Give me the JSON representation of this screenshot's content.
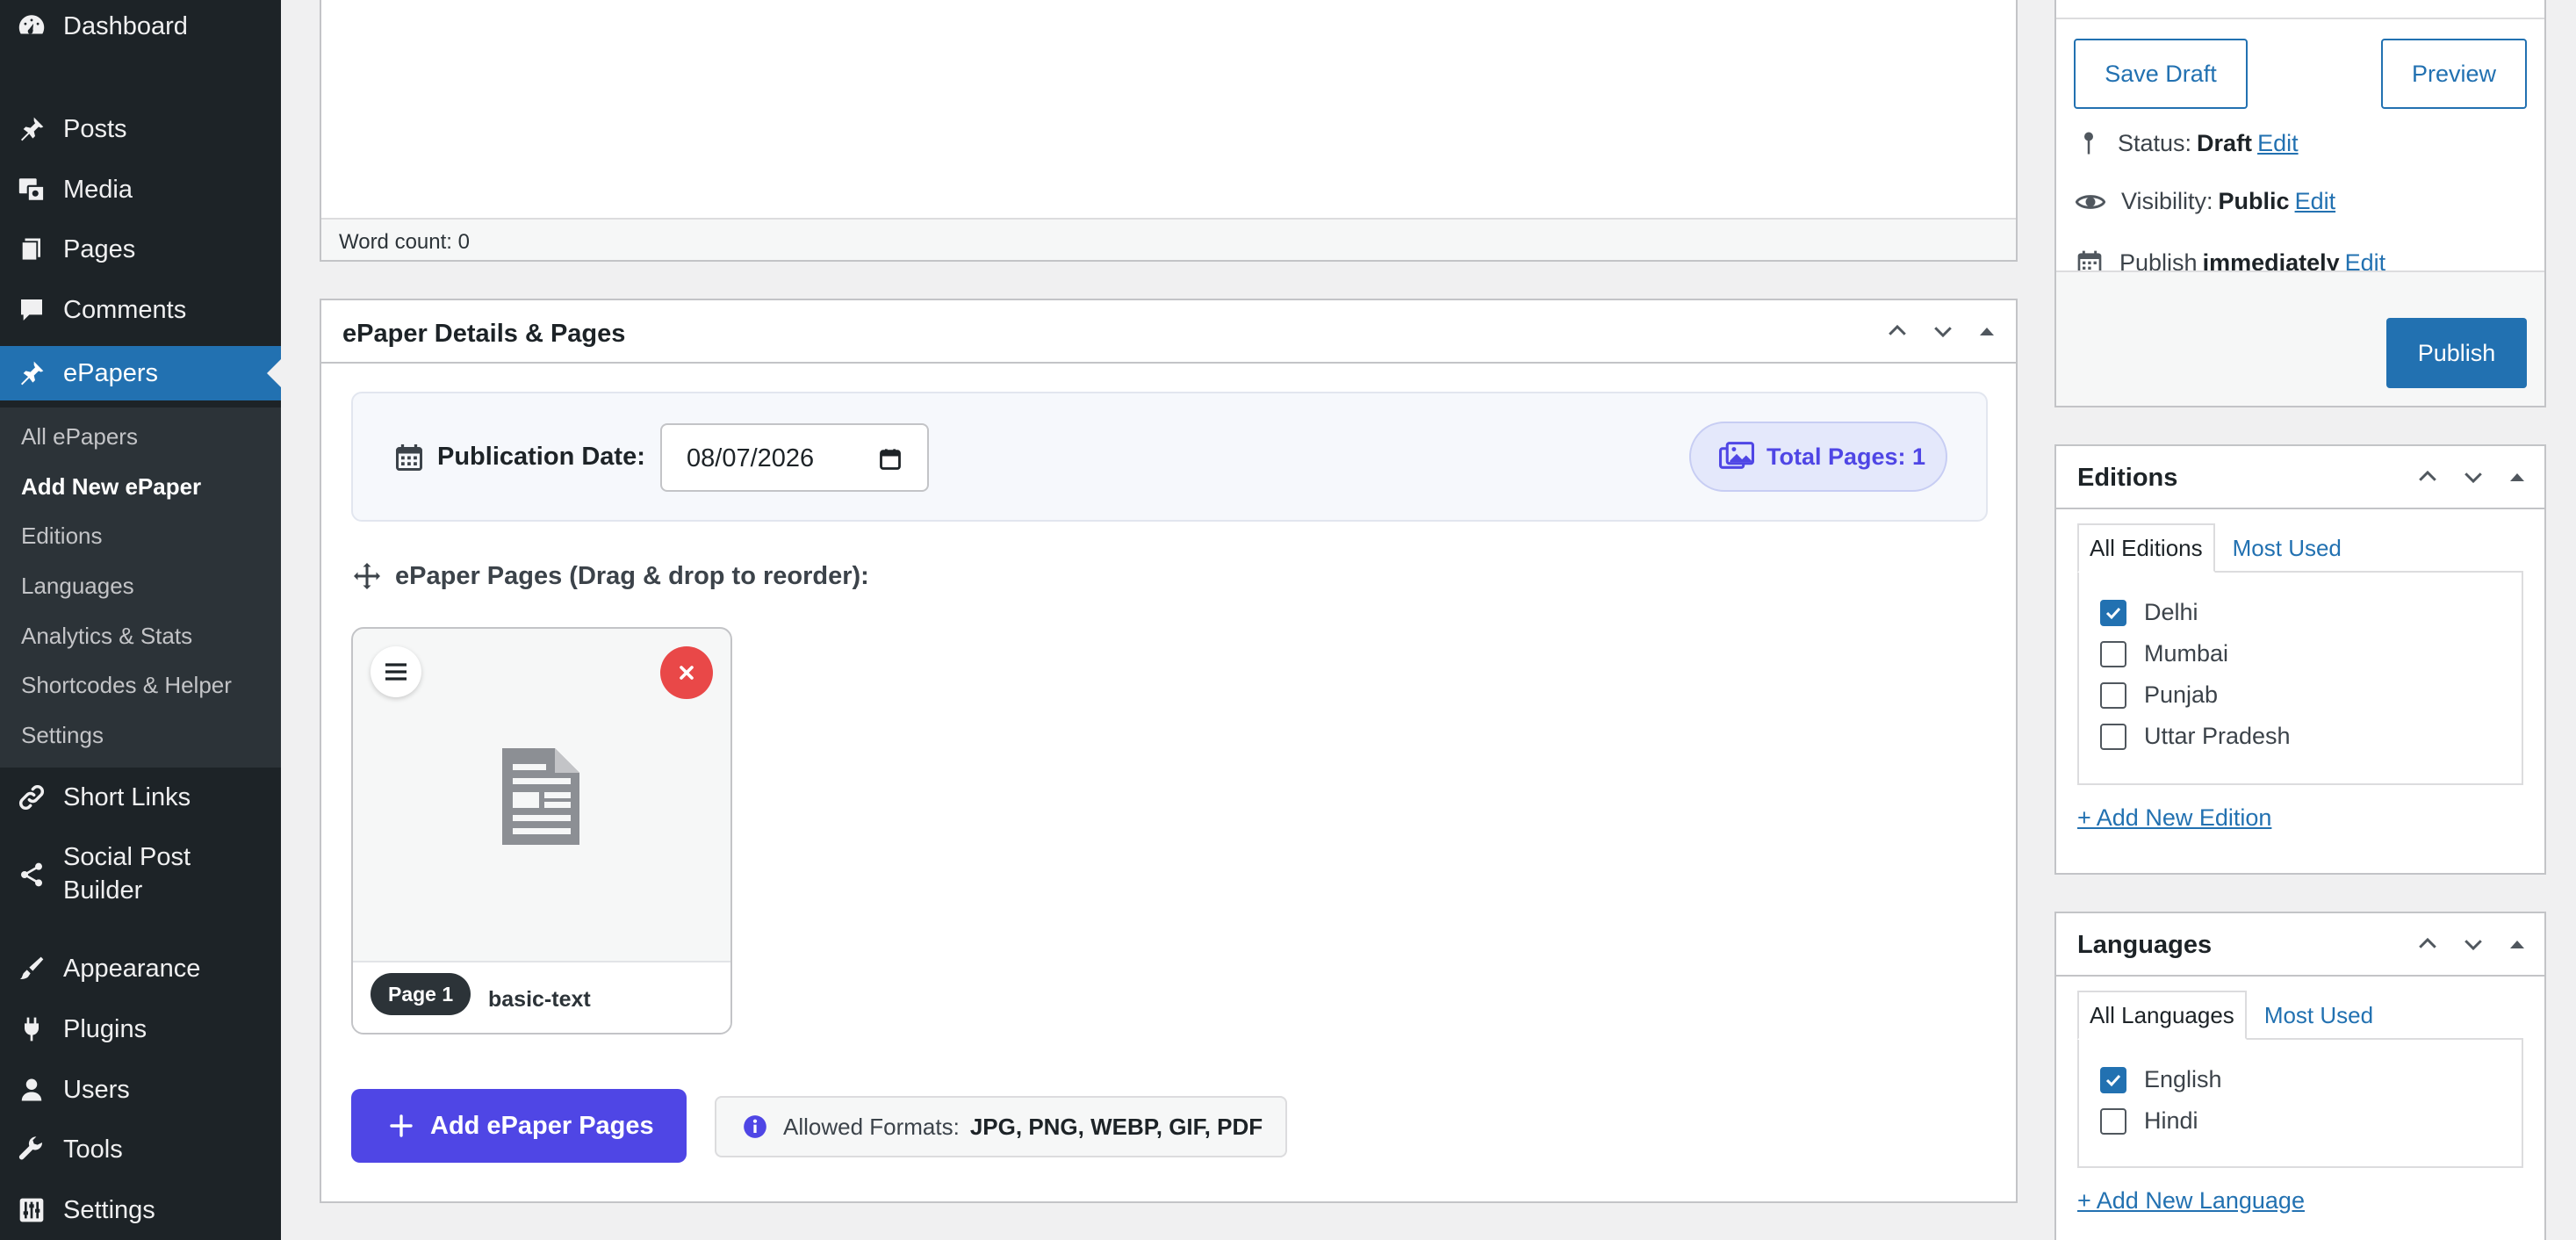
{
  "sidebar": {
    "items": [
      {
        "label": "Dashboard",
        "icon": "dashboard-icon"
      },
      {
        "label": "Posts",
        "icon": "pin-icon"
      },
      {
        "label": "Media",
        "icon": "media-icon"
      },
      {
        "label": "Pages",
        "icon": "pages-icon"
      },
      {
        "label": "Comments",
        "icon": "comment-icon"
      },
      {
        "label": "ePapers",
        "icon": "pin-icon"
      },
      {
        "label": "Short Links",
        "icon": "link-icon"
      },
      {
        "label": "Social Post",
        "label2": "Builder",
        "icon": "share-icon"
      },
      {
        "label": "Appearance",
        "icon": "brush-icon"
      },
      {
        "label": "Plugins",
        "icon": "plug-icon"
      },
      {
        "label": "Users",
        "icon": "user-icon"
      },
      {
        "label": "Tools",
        "icon": "wrench-icon"
      },
      {
        "label": "Settings",
        "icon": "settings-icon"
      }
    ],
    "submenu": [
      "All ePapers",
      "Add New ePaper",
      "Editions",
      "Languages",
      "Analytics & Stats",
      "Shortcodes & Helper",
      "Settings"
    ]
  },
  "editor": {
    "word_count": "Word count: 0"
  },
  "metabox": {
    "title": "ePaper Details & Pages",
    "publication_label": "Publication Date:",
    "publication_date": "08/07/2026",
    "total_pages": "Total Pages: 1",
    "pages_label": "ePaper Pages (Drag & drop to reorder):",
    "page_card": {
      "badge": "Page 1",
      "name": "basic-text"
    },
    "add_button": "Add ePaper Pages",
    "formats_label": "Allowed Formats:",
    "formats_value": "JPG, PNG, WEBP, GIF, PDF"
  },
  "publish": {
    "save_draft": "Save Draft",
    "preview": "Preview",
    "status_label": "Status:",
    "status_value": "Draft",
    "visibility_label": "Visibility:",
    "visibility_value": "Public",
    "publish_label": "Publish",
    "publish_value": "immediately",
    "edit": "Edit",
    "publish_button": "Publish"
  },
  "editions": {
    "title": "Editions",
    "tab_all": "All Editions",
    "tab_most": "Most Used",
    "items": [
      {
        "label": "Delhi",
        "checked": true
      },
      {
        "label": "Mumbai",
        "checked": false
      },
      {
        "label": "Punjab",
        "checked": false
      },
      {
        "label": "Uttar Pradesh",
        "checked": false
      }
    ],
    "add_link": "+ Add New Edition"
  },
  "languages": {
    "title": "Languages",
    "tab_all": "All Languages",
    "tab_most": "Most Used",
    "items": [
      {
        "label": "English",
        "checked": true
      },
      {
        "label": "Hindi",
        "checked": false
      }
    ],
    "add_link": "+ Add New Language"
  },
  "colors": {
    "wp_blue": "#2271b1",
    "accent": "#4f46e5",
    "danger": "#e94848",
    "sidebar": "#1d2327"
  }
}
